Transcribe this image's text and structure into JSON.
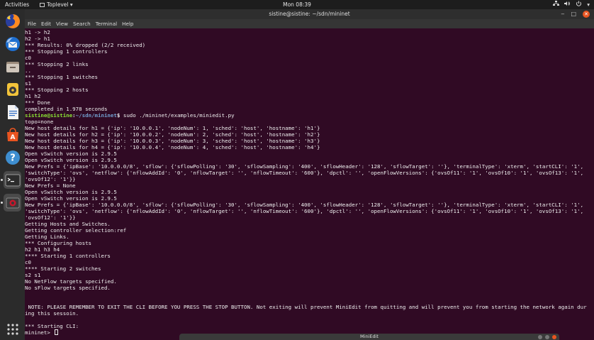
{
  "topbar": {
    "activities": "Activities",
    "app_menu": "Toplevel ▾",
    "clock": "Mon 08:39",
    "tray_icons": [
      "network-icon",
      "volume-icon",
      "power-icon"
    ]
  },
  "dock": {
    "apps": [
      "firefox-icon",
      "thunderbird-icon",
      "files-icon",
      "rhythmbox-icon",
      "writer-icon",
      "software-center-icon",
      "help-icon",
      "terminal-icon",
      "screenshot-icon"
    ],
    "show_apps": "apps-grid-icon"
  },
  "window": {
    "title": "sistine@sistine: ~/sdn/mininet",
    "menu": [
      "File",
      "Edit",
      "View",
      "Search",
      "Terminal",
      "Help"
    ]
  },
  "terminal": {
    "lines": [
      "h1 -> h2",
      "h2 -> h1",
      "*** Results: 0% dropped (2/2 received)",
      "*** Stopping 1 controllers",
      "c0",
      "*** Stopping 2 links",
      "..",
      "*** Stopping 1 switches",
      "s1",
      "*** Stopping 2 hosts",
      "h1 h2",
      "*** Done",
      "completed in 1.978 seconds",
      "",
      "topo=none",
      "New host details for h1 = {'ip': '10.0.0.1', 'nodeNum': 1, 'sched': 'host', 'hostname': 'h1'}",
      "New host details for h2 = {'ip': '10.0.0.2', 'nodeNum': 2, 'sched': 'host', 'hostname': 'h2'}",
      "New host details for h3 = {'ip': '10.0.0.3', 'nodeNum': 3, 'sched': 'host', 'hostname': 'h3'}",
      "New host details for h4 = {'ip': '10.0.0.4', 'nodeNum': 4, 'sched': 'host', 'hostname': 'h4'}",
      "Open vSwitch version is 2.9.5",
      "Open vSwitch version is 2.9.5",
      "New Prefs = {'ipBase': '10.0.0.0/8', 'sflow': {'sflowPolling': '30', 'sflowSampling': '400', 'sflowHeader': '128', 'sflowTarget': ''}, 'terminalType': 'xterm', 'startCLI': '1',",
      "'switchType': 'ovs', 'netflow': {'nflowAddId': '0', 'nflowTarget': '', 'nflowTimeout': '600'}, 'dpctl': '', 'openFlowVersions': {'ovsOf11': '1', 'ovsOf10': '1', 'ovsOf13': '1',",
      "'ovsOf12': '1'}}",
      "New Prefs = None",
      "Open vSwitch version is 2.9.5",
      "Open vSwitch version is 2.9.5",
      "New Prefs = {'ipBase': '10.0.0.0/8', 'sflow': {'sflowPolling': '30', 'sflowSampling': '400', 'sflowHeader': '128', 'sflowTarget': ''}, 'terminalType': 'xterm', 'startCLI': '1',",
      "'switchType': 'ovs', 'netflow': {'nflowAddId': '0', 'nflowTarget': '', 'nflowTimeout': '600'}, 'dpctl': '', 'openFlowVersions': {'ovsOf11': '1', 'ovsOf10': '1', 'ovsOf13': '1',",
      "'ovsOf12': '1'}}",
      "Getting Hosts and Switches.",
      "Getting controller selection:ref",
      "Getting Links.",
      "*** Configuring hosts",
      "h2 h1 h3 h4",
      "**** Starting 1 controllers",
      "c0",
      "**** Starting 2 switches",
      "s2 s1",
      "No NetFlow targets specified.",
      "No sFlow targets specified.",
      "",
      "",
      "",
      " NOTE: PLEASE REMEMBER TO EXIT THE CLI BEFORE YOU PRESS THE STOP BUTTON. Not exiting will prevent MiniEdit from quitting and will prevent you from starting the network again dur",
      "ing this sessoin.",
      "",
      "*** Starting CLI:"
    ],
    "prompt": {
      "user": "sistine@sistine",
      "sep": ":",
      "path": "~/sdn/mininet",
      "symbol": "$",
      "command": " sudo ./mininet/examples/miniedit.py"
    },
    "final_prompt": "mininet> "
  },
  "miniedit": {
    "title": "MiniEdit"
  },
  "colors": {
    "terminal_bg": "#300a24",
    "prompt_user": "#8ae234",
    "prompt_path": "#729fcf",
    "accent": "#e95420"
  }
}
